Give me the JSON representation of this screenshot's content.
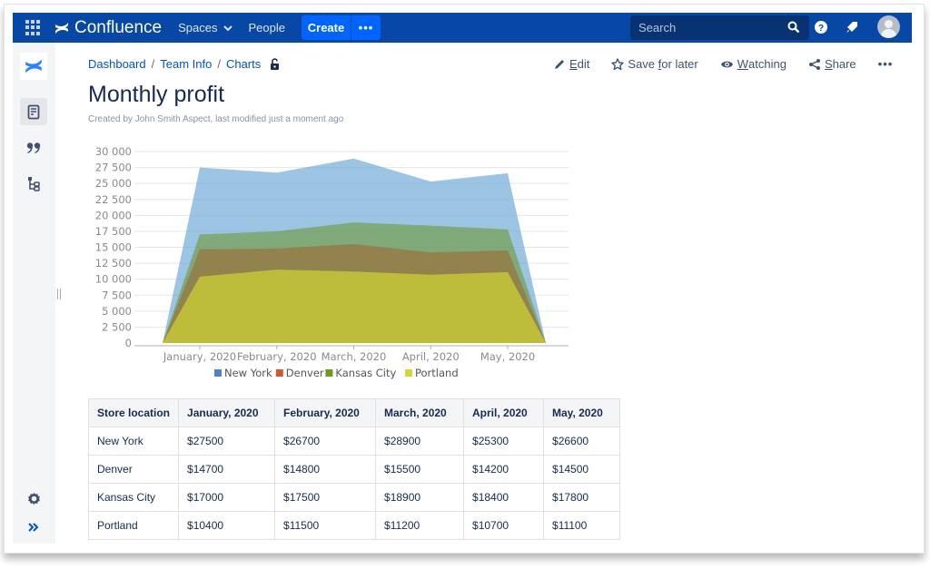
{
  "topbar": {
    "app_name": "Confluence",
    "nav": [
      {
        "label": "Spaces",
        "has_dropdown": true
      },
      {
        "label": "People",
        "has_dropdown": false
      }
    ],
    "create_label": "Create",
    "more_label": "•••",
    "search": {
      "placeholder": "Search",
      "value": ""
    },
    "icons": [
      "app-switcher-icon",
      "search-icon",
      "help-icon",
      "notifications-icon",
      "avatar"
    ],
    "colors": {
      "bar": "#0747a6",
      "create": "#0065ff",
      "search_bg": "#093273"
    }
  },
  "sidebar": {
    "items": [
      {
        "name": "confluence-logo",
        "active": false
      },
      {
        "name": "pages",
        "active": true
      },
      {
        "name": "blog",
        "active": false
      },
      {
        "name": "page-tree",
        "active": false
      },
      {
        "name": "settings",
        "active": false
      },
      {
        "name": "expand",
        "active": false
      }
    ]
  },
  "page": {
    "breadcrumb": [
      "Dashboard",
      "Team Info",
      "Charts"
    ],
    "title": "Monthly profit",
    "byline": "Created by John Smith Aspect, last modified just a moment ago",
    "actions": [
      {
        "label_pre": "",
        "label_u": "E",
        "label_post": "dit",
        "icon": "pencil-icon"
      },
      {
        "label_pre": "Save ",
        "label_u": "f",
        "label_post": "or later",
        "icon": "star-icon"
      },
      {
        "label_pre": "",
        "label_u": "W",
        "label_post": "atching",
        "icon": "eye-icon"
      },
      {
        "label_pre": "",
        "label_u": "S",
        "label_post": "hare",
        "icon": "share-icon"
      }
    ],
    "more_actions_label": "•••"
  },
  "chart_data": {
    "type": "area",
    "title": "",
    "xlabel": "",
    "ylabel": "",
    "categories": [
      "January, 2020",
      "February, 2020",
      "March, 2020",
      "April, 2020",
      "May, 2020"
    ],
    "y_ticks": [
      "0",
      "2 500",
      "5 000",
      "7 500",
      "10 000",
      "12 500",
      "15 000",
      "17 500",
      "20 000",
      "22 500",
      "25 000",
      "27 500",
      "30 000"
    ],
    "ylim": [
      0,
      30000
    ],
    "grid": true,
    "stacked": false,
    "edges_drop_to_zero": true,
    "legend_position": "bottom",
    "series": [
      {
        "name": "New York",
        "color": "#4a86c5",
        "fill": "#9fc3e2",
        "values": [
          27500,
          26700,
          28900,
          25300,
          26600
        ]
      },
      {
        "name": "Denver",
        "color": "#d0582b",
        "fill": "#9f8f3f",
        "values": [
          14700,
          14800,
          15500,
          14200,
          14500
        ]
      },
      {
        "name": "Kansas City",
        "color": "#6f9a1f",
        "fill": "#88ab76",
        "values": [
          17000,
          17500,
          18900,
          18400,
          17800
        ]
      },
      {
        "name": "Portland",
        "color": "#d4d63a",
        "fill": "#bdbc44",
        "values": [
          10400,
          11500,
          11200,
          10700,
          11100
        ]
      }
    ]
  },
  "table": {
    "headers": [
      "Store location",
      "January, 2020",
      "February, 2020",
      "March, 2020",
      "April, 2020",
      "May, 2020"
    ],
    "rows": [
      [
        "New York",
        "$27500",
        "$26700",
        "$28900",
        "$25300",
        "$26600"
      ],
      [
        "Denver",
        "$14700",
        "$14800",
        "$15500",
        "$14200",
        "$14500"
      ],
      [
        "Kansas City",
        "$17000",
        "$17500",
        "$18900",
        "$18400",
        "$17800"
      ],
      [
        "Portland",
        "$10400",
        "$11500",
        "$11200",
        "$10700",
        "$11100"
      ]
    ]
  }
}
